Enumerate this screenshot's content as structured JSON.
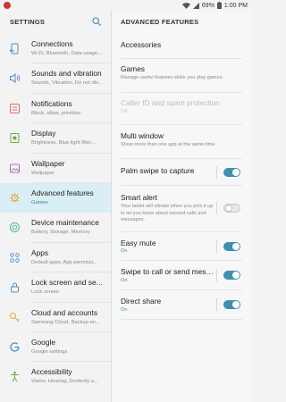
{
  "status_bar": {
    "battery": "69%",
    "time": "1:00 PM"
  },
  "left_panel": {
    "title": "SETTINGS",
    "items": [
      {
        "icon": "connections-icon",
        "title": "Connections",
        "subtitle": "Wi-Fi, Bluetooth, Data usage..."
      },
      {
        "icon": "sounds-icon",
        "title": "Sounds and vibration",
        "subtitle": "Sounds, Vibration, Do not dis..."
      },
      {
        "icon": "notifications-icon",
        "title": "Notifications",
        "subtitle": "Block, allow, prioritize"
      },
      {
        "icon": "display-icon",
        "title": "Display",
        "subtitle": "Brightness, Blue light filter,..."
      },
      {
        "icon": "wallpaper-icon",
        "title": "Wallpaper",
        "subtitle": "Wallpaper"
      },
      {
        "icon": "advanced-features-icon",
        "title": "Advanced features",
        "subtitle": "Games",
        "active": true
      },
      {
        "icon": "device-maintenance-icon",
        "title": "Device maintenance",
        "subtitle": "Battery, Storage, Memory"
      },
      {
        "icon": "apps-icon",
        "title": "Apps",
        "subtitle": "Default apps, App permissi..."
      },
      {
        "icon": "lock-screen-icon",
        "title": "Lock screen and se...",
        "subtitle": "Lock screen"
      },
      {
        "icon": "cloud-accounts-icon",
        "title": "Cloud and accounts",
        "subtitle": "Samsung Cloud, Backup an..."
      },
      {
        "icon": "google-icon",
        "title": "Google",
        "subtitle": "Google settings"
      },
      {
        "icon": "accessibility-icon",
        "title": "Accessibility",
        "subtitle": "Vision, Hearing, Dexterity a..."
      }
    ]
  },
  "right_panel": {
    "title": "ADVANCED FEATURES",
    "items": [
      {
        "title": "Accessories",
        "subtitle": ""
      },
      {
        "title": "Games",
        "subtitle": "Manage useful features while you play games."
      },
      {
        "title": "Caller ID and spam protection",
        "subtitle": "Off",
        "disabled": true
      },
      {
        "title": "Multi window",
        "subtitle": "Show more than one app at the same time."
      },
      {
        "title": "Palm swipe to capture",
        "subtitle": "",
        "toggle": "on"
      },
      {
        "title": "Smart alert",
        "subtitle": "Your tablet will vibrate when you pick it up to let you know about missed calls and messages.",
        "toggle": "off"
      },
      {
        "title": "Easy mute",
        "subtitle": "On",
        "toggle": "on"
      },
      {
        "title": "Swipe to call or send mess...",
        "subtitle": "On",
        "toggle": "on"
      },
      {
        "title": "Direct share",
        "subtitle": "On",
        "toggle": "on"
      }
    ]
  },
  "colors": {
    "accent": "#3e8fb0",
    "active_bg": "#d9eef5",
    "notification_dot": "#d0342c"
  }
}
